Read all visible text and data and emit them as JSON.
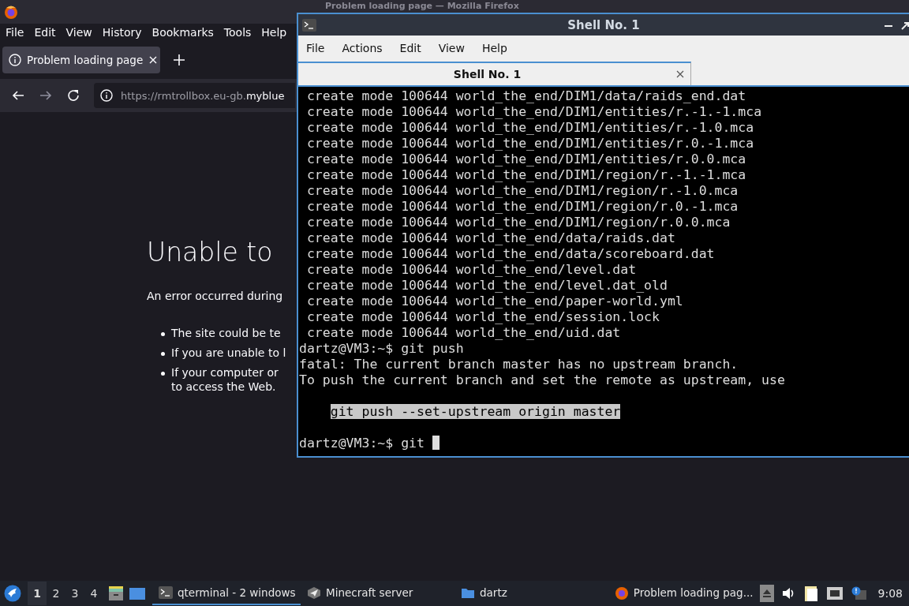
{
  "browser": {
    "title": "Problem loading page — Mozilla Firefox",
    "menu": [
      "File",
      "Edit",
      "View",
      "History",
      "Bookmarks",
      "Tools",
      "Help"
    ],
    "tabs": [
      {
        "label": "Problem loading page",
        "selected": true
      }
    ],
    "url": {
      "dim": "https://rmtrollbox.eu-gb.",
      "bright": "myblue"
    },
    "error": {
      "heading": "Unable to",
      "intro": "An error occurred during",
      "bullets": [
        "The site could be te",
        "If you are unable to l",
        "If your computer or\nto access the Web."
      ]
    }
  },
  "terminal": {
    "title": "Shell No. 1",
    "menu": [
      "File",
      "Actions",
      "Edit",
      "View",
      "Help"
    ],
    "tabs": [
      {
        "label": "Shell No. 1",
        "selected": true
      }
    ],
    "lines": [
      {
        "kind": "output",
        "text": " create mode 100644 world_the_end/DIM1/data/raids_end.dat"
      },
      {
        "kind": "output",
        "text": " create mode 100644 world_the_end/DIM1/entities/r.-1.-1.mca"
      },
      {
        "kind": "output",
        "text": " create mode 100644 world_the_end/DIM1/entities/r.-1.0.mca"
      },
      {
        "kind": "output",
        "text": " create mode 100644 world_the_end/DIM1/entities/r.0.-1.mca"
      },
      {
        "kind": "output",
        "text": " create mode 100644 world_the_end/DIM1/entities/r.0.0.mca"
      },
      {
        "kind": "output",
        "text": " create mode 100644 world_the_end/DIM1/region/r.-1.-1.mca"
      },
      {
        "kind": "output",
        "text": " create mode 100644 world_the_end/DIM1/region/r.-1.0.mca"
      },
      {
        "kind": "output",
        "text": " create mode 100644 world_the_end/DIM1/region/r.0.-1.mca"
      },
      {
        "kind": "output",
        "text": " create mode 100644 world_the_end/DIM1/region/r.0.0.mca"
      },
      {
        "kind": "output",
        "text": " create mode 100644 world_the_end/data/raids.dat"
      },
      {
        "kind": "output",
        "text": " create mode 100644 world_the_end/data/scoreboard.dat"
      },
      {
        "kind": "output",
        "text": " create mode 100644 world_the_end/level.dat"
      },
      {
        "kind": "output",
        "text": " create mode 100644 world_the_end/level.dat_old"
      },
      {
        "kind": "output",
        "text": " create mode 100644 world_the_end/paper-world.yml"
      },
      {
        "kind": "output",
        "text": " create mode 100644 world_the_end/session.lock"
      },
      {
        "kind": "output",
        "text": " create mode 100644 world_the_end/uid.dat"
      },
      {
        "kind": "output",
        "text": "dartz@VM3:~$ git push"
      },
      {
        "kind": "output",
        "text": "fatal: The current branch master has no upstream branch."
      },
      {
        "kind": "output",
        "text": "To push the current branch and set the remote as upstream, use"
      },
      {
        "kind": "blank"
      },
      {
        "kind": "selection",
        "text": "    git push --set-upstream origin master"
      },
      {
        "kind": "blank"
      },
      {
        "kind": "input",
        "text": "dartz@VM3:~$ git "
      }
    ]
  },
  "taskbar": {
    "workspaces": [
      {
        "label": "1",
        "selected": true
      },
      {
        "label": "2",
        "selected": false
      },
      {
        "label": "3",
        "selected": false
      },
      {
        "label": "4",
        "selected": false
      }
    ],
    "tasks": [
      {
        "label": "qterminal - 2 windows",
        "kind": "terminal",
        "selected": true
      },
      {
        "label": "Minecraft server",
        "kind": "app",
        "selected": false
      },
      {
        "label": "dartz",
        "kind": "folder",
        "selected": false
      },
      {
        "label": "Problem loading pag...",
        "kind": "browser",
        "selected": false
      }
    ],
    "clock": "9:08"
  }
}
